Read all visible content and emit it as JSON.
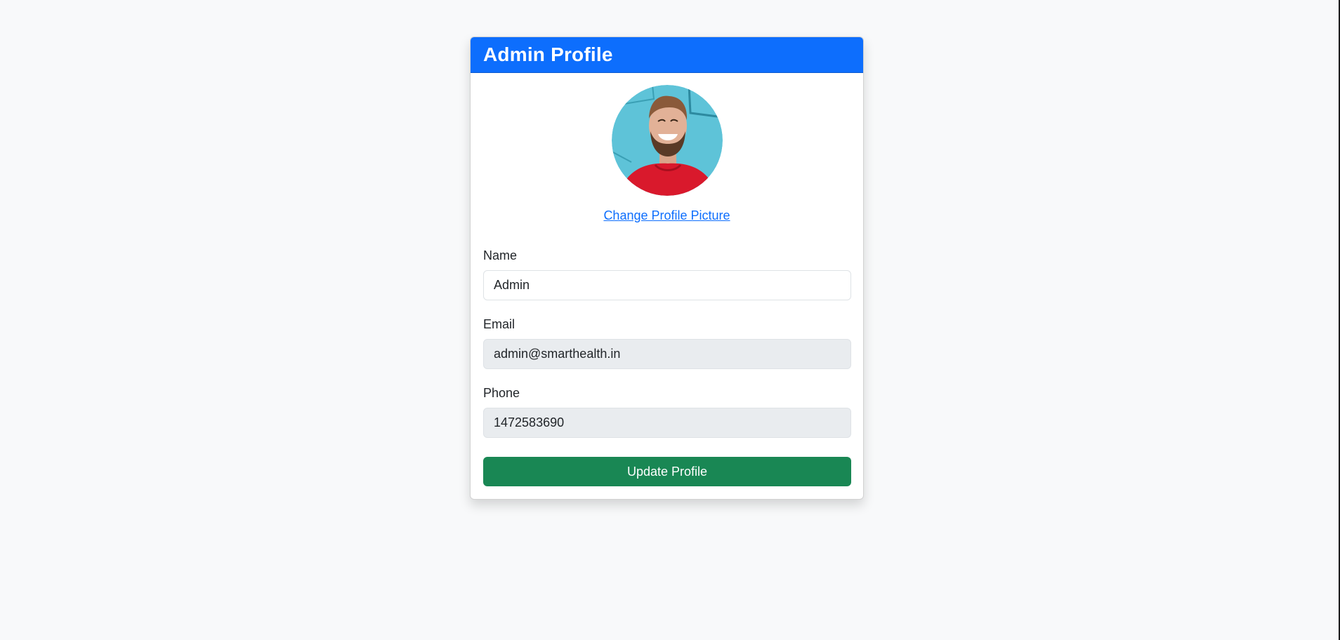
{
  "colors": {
    "page_background": "#f8f9fa",
    "header_background": "#0d6efd",
    "link": "#0d6efd",
    "update_button": "#198754",
    "readonly_field": "#e9ecef"
  },
  "profile": {
    "title": "Admin Profile",
    "avatar_icon": "user-avatar-photo",
    "change_picture_label": "Change Profile Picture"
  },
  "form": {
    "name": {
      "label": "Name",
      "value": "Admin"
    },
    "email": {
      "label": "Email",
      "value": "admin@smarthealth.in",
      "readonly": true
    },
    "phone": {
      "label": "Phone",
      "value": "1472583690",
      "readonly": true
    },
    "submit_label": "Update Profile"
  }
}
